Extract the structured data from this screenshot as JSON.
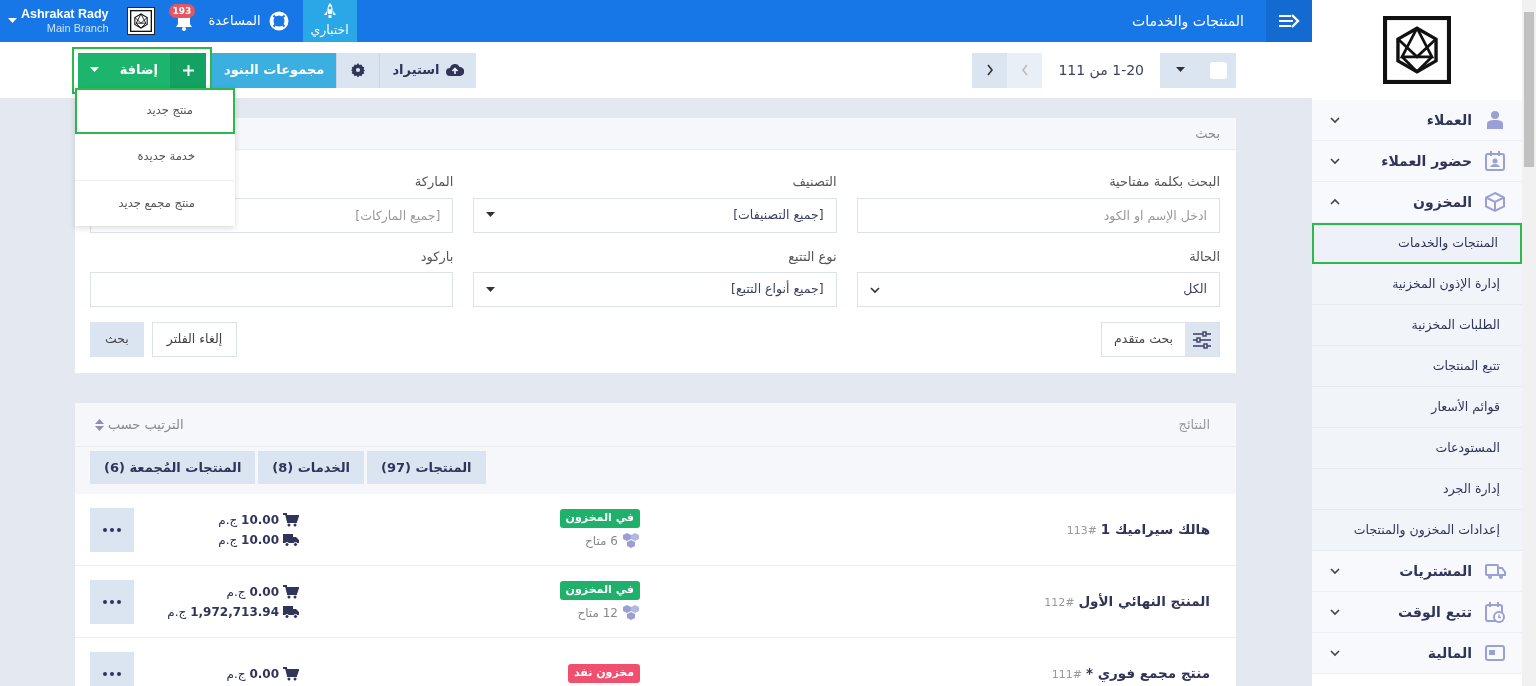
{
  "topbar": {
    "title": "المنتجات والخدمات",
    "trial": "اختباري",
    "help": "المساعدة",
    "notifications": "193",
    "user_name": "Ashrakat Rady",
    "branch": "Main Branch"
  },
  "toolbar": {
    "select_all_checked": false,
    "pagination": "1-20 من 111",
    "prev_disabled": true,
    "next_disabled": false,
    "import": "استيراد",
    "groups": "مجموعات البنود",
    "add": "إضافة",
    "add_highlighted": true,
    "add_menu": [
      {
        "label": "منتج جديد",
        "highlighted": true
      },
      {
        "label": "خدمة جديدة",
        "highlighted": false
      },
      {
        "label": "منتج مجمع جديد",
        "highlighted": false
      }
    ]
  },
  "search": {
    "title": "بحث",
    "fields": [
      {
        "label": "البحث بكلمة مفتاحية",
        "kind": "input",
        "placeholder": "ادخل الإسم او الكود"
      },
      {
        "label": "التصنيف",
        "kind": "dropdown",
        "value": "[جميع التصنيفات]"
      },
      {
        "label": "الماركة",
        "kind": "input",
        "placeholder": "[جميع الماركات]"
      },
      {
        "label": "الحالة",
        "kind": "select",
        "value": "الكل"
      },
      {
        "label": "نوع التتبع",
        "kind": "dropdown",
        "value": "[جميع أنواع التتبع]"
      },
      {
        "label": "باركود",
        "kind": "input"
      }
    ],
    "advanced": "بحث متقدم",
    "buttons": [
      {
        "label": "إلغاء الفلتر",
        "kind": "secondary"
      },
      {
        "label": "بحث",
        "kind": "primary"
      }
    ]
  },
  "results": {
    "title": "النتائج",
    "sort": "الترتيب حسب",
    "tabs": [
      "المنتجات (97)",
      "الخدمات (8)",
      "المنتجات المُجمعة (6)"
    ],
    "rows": [
      {
        "name": "هالك سيراميك 1",
        "number": "113#",
        "status": "في المخزون",
        "color": "#1fb06b",
        "available": "6 متاح",
        "prices": [
          {
            "kind": "sale",
            "text": "**10.00** ج.م"
          },
          {
            "kind": "purchase",
            "text": "**10.00** ج.م"
          }
        ]
      },
      {
        "name": "المنتج النهائي الأول",
        "number": "112#",
        "status": "في المخزون",
        "color": "#1fb06b",
        "available": "12 متاح",
        "prices": [
          {
            "kind": "sale",
            "text": "**0.00** ج.م"
          },
          {
            "kind": "purchase",
            "text": "**1,972,713.94** ج.م"
          }
        ]
      },
      {
        "name": "منتج مجمع فوري *",
        "number": "111#",
        "status": "مخزون نفد",
        "color": "#f0506e",
        "prices": [
          {
            "kind": "sale",
            "text": "**0.00** ج.م"
          }
        ]
      }
    ]
  },
  "sidebar": {
    "items": [
      {
        "label": "العملاء",
        "expanded": false
      },
      {
        "label": "حضور العملاء",
        "expanded": false
      },
      {
        "label": "المخزون",
        "expanded": true,
        "children": [
          {
            "label": "المنتجات والخدمات",
            "selected": true
          },
          {
            "label": "إدارة الإذون المخزنية",
            "selected": false
          },
          {
            "label": "الطلبات المخزنية",
            "selected": false
          },
          {
            "label": "تتبع المنتجات",
            "selected": false
          },
          {
            "label": "قوائم الأسعار",
            "selected": false
          },
          {
            "label": "المستودعات",
            "selected": false
          },
          {
            "label": "إدارة الجرد",
            "selected": false
          },
          {
            "label": "إعدادات المخزون والمنتجات",
            "selected": false
          }
        ]
      },
      {
        "label": "المشتريات",
        "expanded": false
      },
      {
        "label": "تتبع الوقت",
        "expanded": false
      },
      {
        "label": "المالية",
        "expanded": false
      }
    ]
  }
}
